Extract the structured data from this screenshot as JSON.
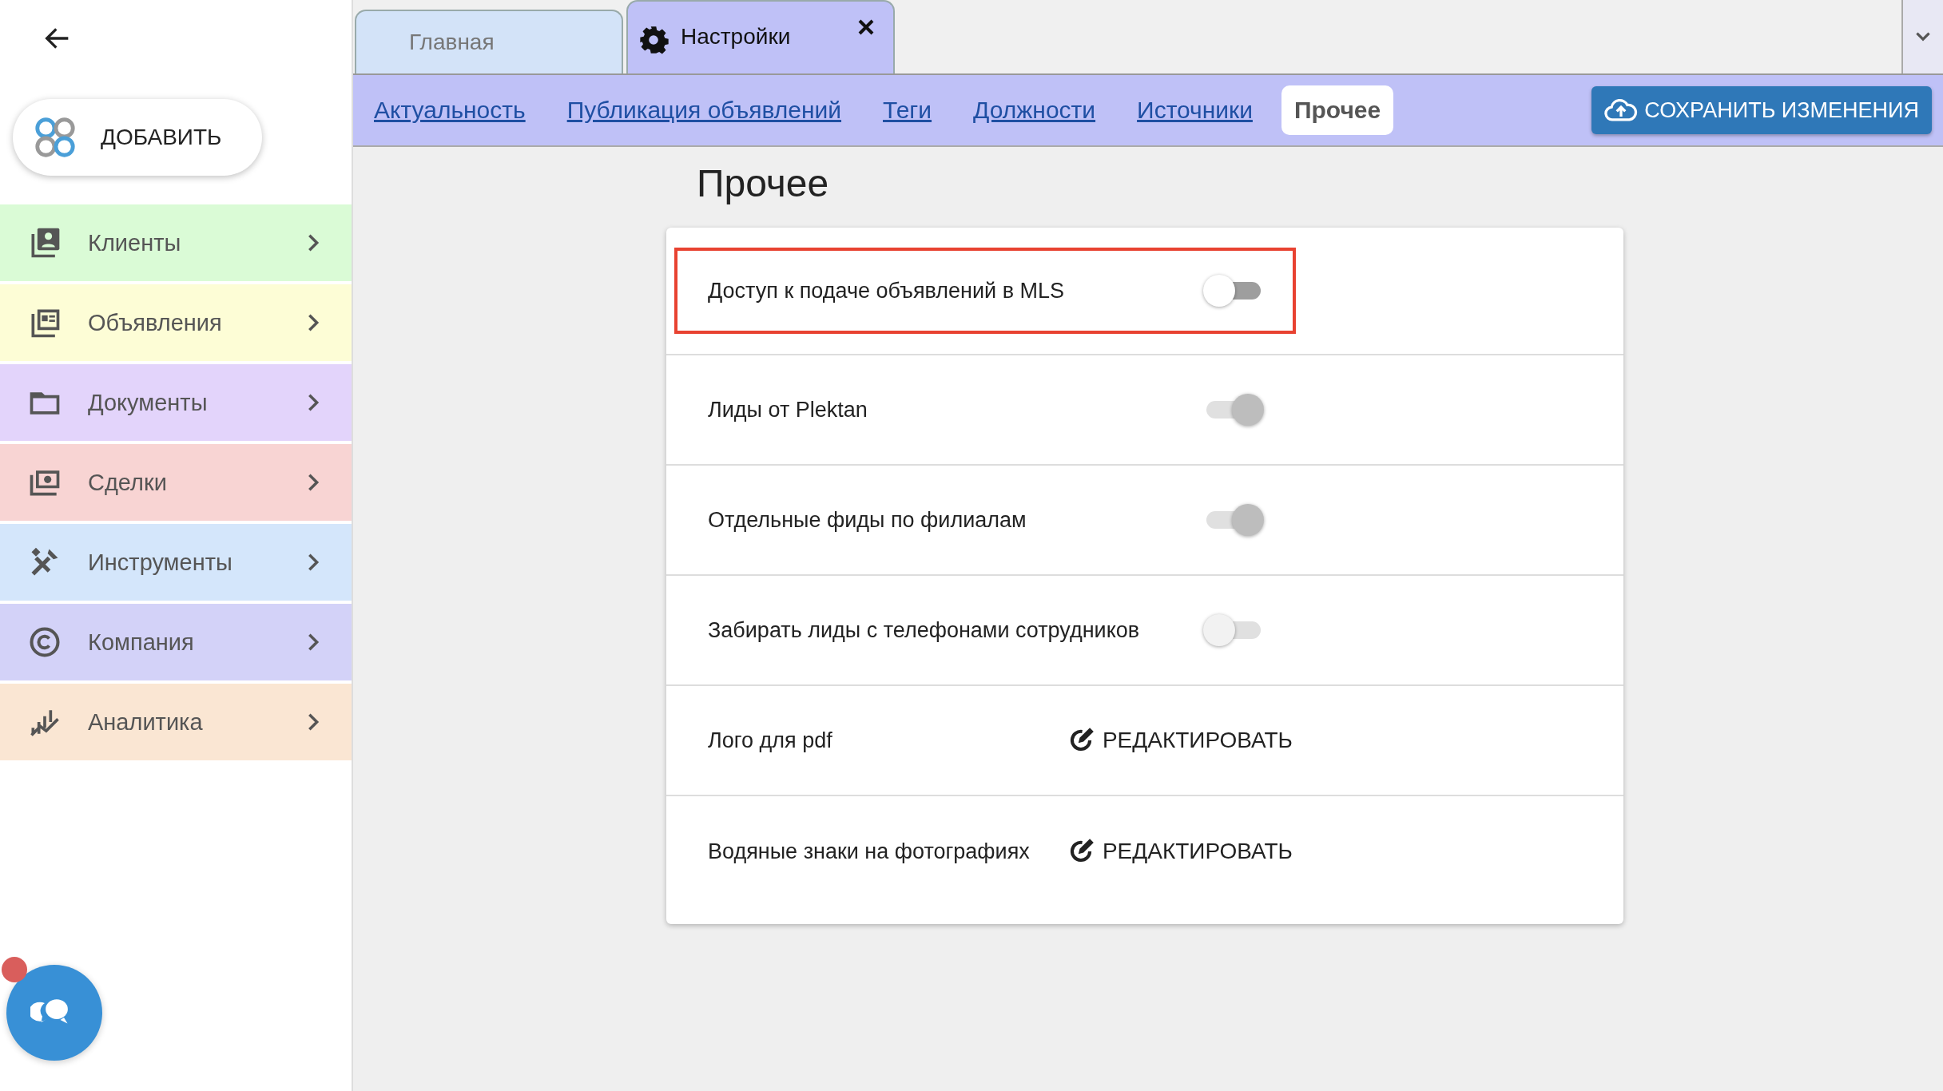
{
  "sidebar": {
    "add_button": "ДОБАВИТЬ",
    "items": [
      {
        "label": "Клиенты",
        "color": "#dafbd6"
      },
      {
        "label": "Объявления",
        "color": "#fdfdd6"
      },
      {
        "label": "Документы",
        "color": "#e3d4fb"
      },
      {
        "label": "Сделки",
        "color": "#f8d4d3"
      },
      {
        "label": "Инструменты",
        "color": "#d4e6fb"
      },
      {
        "label": "Компания",
        "color": "#d3d2f8"
      },
      {
        "label": "Аналитика",
        "color": "#fae6d3"
      }
    ]
  },
  "tabs": [
    {
      "label": "Главная",
      "selected": false
    },
    {
      "label": "Настройки",
      "selected": true
    }
  ],
  "subnav": [
    {
      "label": "Актуальность",
      "selected": false
    },
    {
      "label": "Публикация объявлений",
      "selected": false
    },
    {
      "label": "Теги",
      "selected": false
    },
    {
      "label": "Должности",
      "selected": false
    },
    {
      "label": "Источники",
      "selected": false
    },
    {
      "label": "Прочее",
      "selected": true
    }
  ],
  "save_button": "СОХРАНИТЬ ИЗМЕНЕНИЯ",
  "heading": "Прочее",
  "settings": [
    {
      "kind": "toggle",
      "label": "Доступ к подаче объявлений в MLS",
      "on": false,
      "disabled": false,
      "highlighted": true
    },
    {
      "kind": "toggle",
      "label": "Лиды от Plektan",
      "on": true,
      "disabled": true,
      "highlighted": false
    },
    {
      "kind": "toggle",
      "label": "Отдельные фиды по филиалам",
      "on": true,
      "disabled": true,
      "highlighted": false
    },
    {
      "kind": "toggle",
      "label": "Забирать лиды с телефонами сотрудников",
      "on": false,
      "disabled": true,
      "highlighted": false
    },
    {
      "kind": "edit",
      "label": "Лого для pdf",
      "action": "РЕДАКТИРОВАТЬ",
      "highlighted": false
    },
    {
      "kind": "edit",
      "label": "Водяные знаки на фотографиях",
      "action": "РЕДАКТИРОВАТЬ",
      "highlighted": false
    }
  ]
}
